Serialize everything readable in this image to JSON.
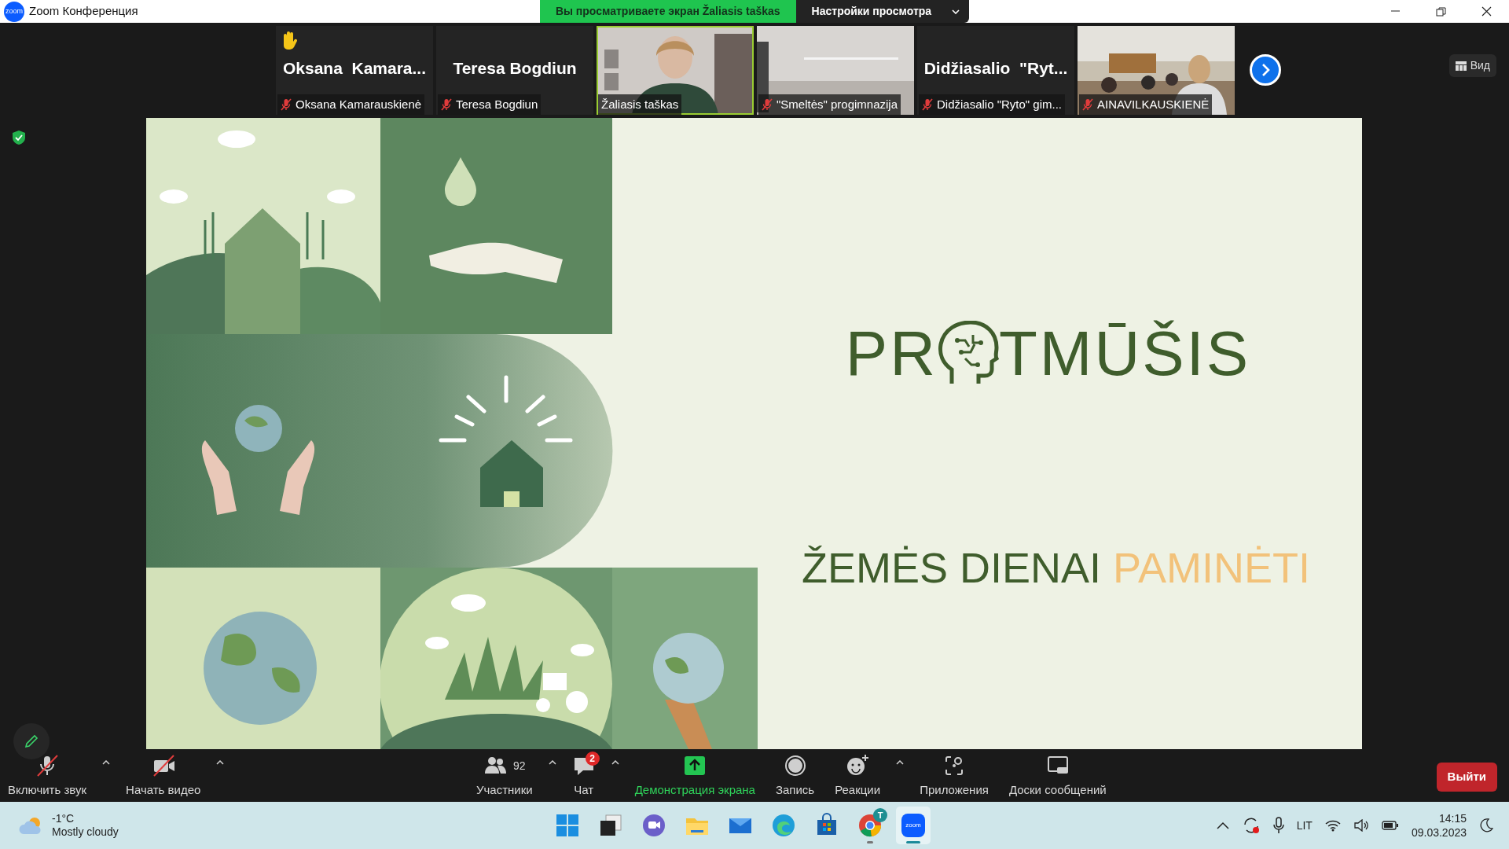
{
  "window": {
    "app_icon_text": "zoom",
    "title": "Zoom Конференция"
  },
  "share_banner": {
    "viewing": "Вы просматриваете экран Žaliasis taškas",
    "options": "Настройки просмотра"
  },
  "view_button": {
    "label": "Вид"
  },
  "tiles": [
    {
      "kind": "name",
      "display_name": "Oksana  Kamara...",
      "label": "Oksana Kamarauskienė",
      "muted": true,
      "hand_raised": true,
      "highlighted": false
    },
    {
      "kind": "name",
      "display_name": "Teresa Bogdiun",
      "label": "Teresa Bogdiun",
      "muted": true,
      "hand_raised": false,
      "highlighted": false
    },
    {
      "kind": "video",
      "label": "Žaliasis taškas",
      "muted": false,
      "hand_raised": false,
      "highlighted": true
    },
    {
      "kind": "video",
      "label": "\"Smeltės\" progimnazija",
      "muted": true,
      "hand_raised": false,
      "highlighted": false
    },
    {
      "kind": "name",
      "display_name": "Didžiasalio  \"Ryt...",
      "label": "Didžiasalio \"Ryto\" gim...",
      "muted": true,
      "hand_raised": false,
      "highlighted": false
    },
    {
      "kind": "video",
      "label": "AINAVILKAUSKIENĖ",
      "muted": true,
      "hand_raised": false,
      "highlighted": false
    }
  ],
  "slide": {
    "title_before": "PR",
    "title_after": "TMŪŠIS",
    "subtitle": "ŽEMĖS DIENAI",
    "subtitle_highlight": "PAMINĖTI"
  },
  "toolbar": [
    {
      "kind": "mic",
      "label": "Включить звук",
      "off": true,
      "menu": true,
      "active": false
    },
    {
      "kind": "video",
      "label": "Начать видео",
      "off": true,
      "menu": true,
      "active": false
    },
    {
      "kind": "participants",
      "label": "Участники",
      "count": "92",
      "off": false,
      "menu": true,
      "active": false
    },
    {
      "kind": "chat",
      "label": "Чат",
      "badge": "2",
      "off": false,
      "menu": true,
      "active": false
    },
    {
      "kind": "share",
      "label": "Демонстрация экрана",
      "off": false,
      "menu": false,
      "active": true
    },
    {
      "kind": "record",
      "label": "Запись",
      "off": false,
      "menu": false,
      "active": false
    },
    {
      "kind": "reactions",
      "label": "Реакции",
      "off": false,
      "menu": true,
      "active": false
    },
    {
      "kind": "apps",
      "label": "Приложения",
      "off": false,
      "menu": false,
      "active": false
    },
    {
      "kind": "whiteboards",
      "label": "Доски сообщений",
      "off": false,
      "menu": false,
      "active": false
    }
  ],
  "leave_button": {
    "label": "Выйти"
  },
  "taskbar": {
    "weather": {
      "temperature": "-1°C",
      "condition": "Mostly cloudy"
    },
    "apps": [
      {
        "kind": "start",
        "running": false,
        "selected": false
      },
      {
        "kind": "taskview",
        "running": false,
        "selected": false
      },
      {
        "kind": "teams",
        "running": false,
        "selected": false
      },
      {
        "kind": "explorer",
        "running": false,
        "selected": false
      },
      {
        "kind": "mail",
        "running": false,
        "selected": false
      },
      {
        "kind": "edge",
        "running": false,
        "selected": false
      },
      {
        "kind": "store",
        "running": false,
        "selected": false
      },
      {
        "kind": "chrome",
        "badge": "T",
        "running": true,
        "selected": false
      },
      {
        "kind": "zoom",
        "label": "zoom",
        "running": true,
        "selected": true
      }
    ],
    "language": "LIT",
    "time": "14:15",
    "date": "09.03.2023"
  }
}
